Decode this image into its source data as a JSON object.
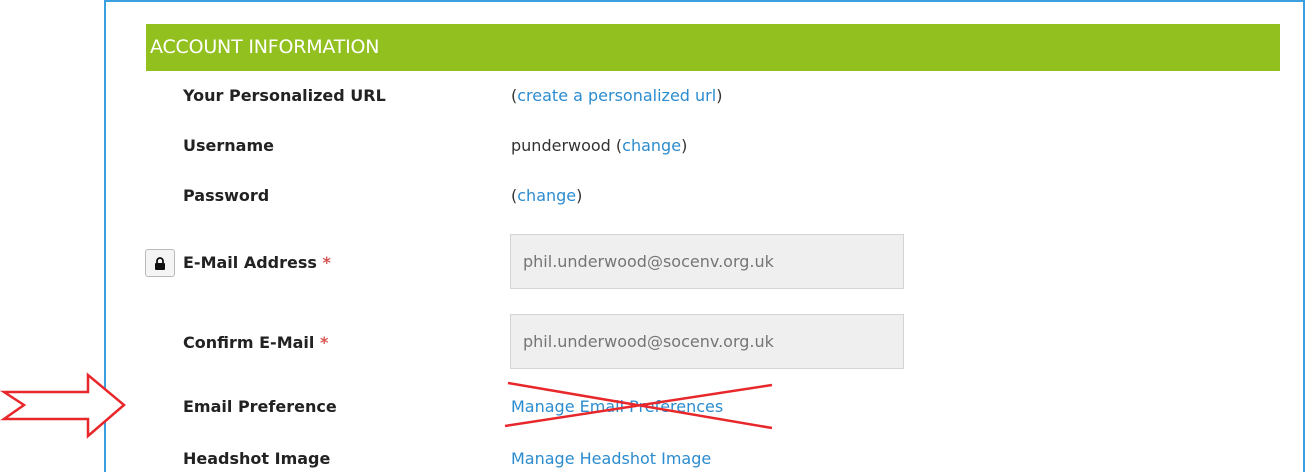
{
  "section_header": "ACCOUNT INFORMATION",
  "rows": {
    "personalized_url": {
      "label": "Your Personalized URL",
      "open_paren": "(",
      "link": "create a personalized url",
      "close_paren": ")"
    },
    "username": {
      "label": "Username",
      "value": "punderwood",
      "open_paren": " (",
      "link": "change",
      "close_paren": ")"
    },
    "password": {
      "label": "Password",
      "open_paren": "(",
      "link": "change",
      "close_paren": ")"
    },
    "email": {
      "label": "E-Mail Address",
      "required": "*",
      "placeholder": "phil.underwood@socenv.org.uk"
    },
    "confirm_email": {
      "label": "Confirm E-Mail",
      "required": "*",
      "placeholder": "phil.underwood@socenv.org.uk"
    },
    "email_preference": {
      "label": "Email Preference",
      "link": "Manage Email Preferences"
    },
    "headshot": {
      "label": "Headshot Image",
      "link": "Manage Headshot Image"
    }
  },
  "colors": {
    "header_bg": "#92c01f",
    "link": "#2b8ccf",
    "frame_border": "#3aa0e0",
    "required": "#d9534f",
    "annotation_red": "#e8272b"
  },
  "icons": {
    "lock_button": "lock-icon",
    "annotation_arrow": "arrow-right-icon",
    "annotation_cross": "cross-out-icon"
  }
}
